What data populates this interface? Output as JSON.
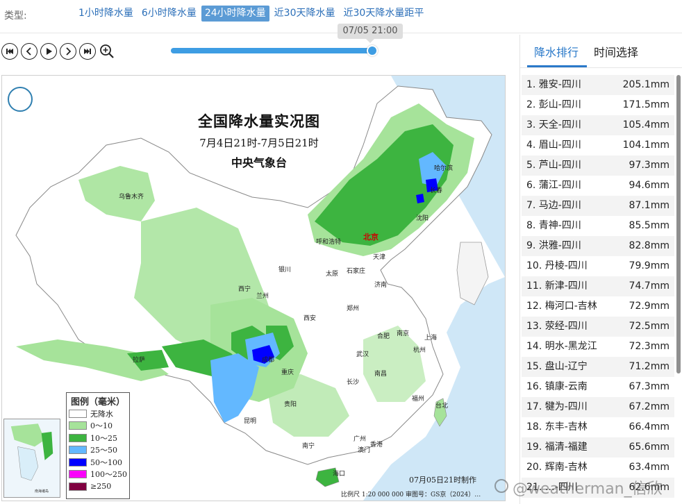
{
  "typebar": {
    "label": "类型:",
    "tabs": [
      "1小时降水量",
      "6小时降水量",
      "24小时降水量",
      "近30天降水量",
      "近30天降水量距平"
    ],
    "active_index": 2
  },
  "timeline": {
    "tooltip": "07/05 21:00",
    "progress": 1.0
  },
  "controls": {
    "icons": [
      "skip-to-start-icon",
      "previous-icon",
      "play-icon",
      "next-icon",
      "skip-to-end-icon",
      "zoom-in-icon"
    ]
  },
  "map": {
    "title": "全国降水量实况图",
    "period": "7月4日21时-7月5日21时",
    "agency": "中央气象台",
    "cities": {
      "urumqi": "乌鲁木齐",
      "lhasa": "拉萨",
      "xining": "西宁",
      "lanzhou": "兰州",
      "yinchuan": "银川",
      "hohhot": "呼和浩特",
      "taiyuan": "太原",
      "shijiazhuang": "石家庄",
      "beijing": "北京",
      "tianjin": "天津",
      "jinan": "济南",
      "zhengzhou": "郑州",
      "xian": "西安",
      "chengdu": "成都",
      "chongqing": "重庆",
      "guiyang": "贵阳",
      "kunming": "昆明",
      "nanning": "南宁",
      "guangzhou": "广州",
      "hongkong": "香港",
      "macau": "澳门",
      "haikou": "海口",
      "changsha": "长沙",
      "wuhan": "武汉",
      "nanchang": "南昌",
      "hefei": "合肥",
      "nanjing": "南京",
      "shanghai": "上海",
      "hangzhou": "杭州",
      "fuzhou": "福州",
      "taipei": "台北",
      "shenyang": "沈阳",
      "changchun": "长春",
      "harbin": "哈尔滨"
    },
    "legend": {
      "title": "图例（毫米）",
      "items": [
        {
          "label": "无降水",
          "color": "#ffffff"
        },
        {
          "label": "0～10",
          "color": "#a6e39a"
        },
        {
          "label": "10～25",
          "color": "#3db440"
        },
        {
          "label": "25～50",
          "color": "#63b8ff"
        },
        {
          "label": "50～100",
          "color": "#0000ff"
        },
        {
          "label": "100～250",
          "color": "#fa00fa"
        },
        {
          "label": "≥250",
          "color": "#800040"
        }
      ]
    },
    "footer_made": "07月05日21时制作",
    "footer_scale": "比例尺 1:20 000 000   审图号：GS京（2024）…",
    "watermark": "@weatherman_信欣"
  },
  "ranking": {
    "tabs": [
      "降水排行",
      "时间选择"
    ],
    "active_index": 0,
    "items": [
      {
        "rank": "1.",
        "name": "雅安-四川",
        "value": "205.1mm"
      },
      {
        "rank": "2.",
        "name": "彭山-四川",
        "value": "171.5mm"
      },
      {
        "rank": "3.",
        "name": "天全-四川",
        "value": "105.4mm"
      },
      {
        "rank": "4.",
        "name": "眉山-四川",
        "value": "104.1mm"
      },
      {
        "rank": "5.",
        "name": "芦山-四川",
        "value": "97.3mm"
      },
      {
        "rank": "6.",
        "name": "蒲江-四川",
        "value": "94.6mm"
      },
      {
        "rank": "7.",
        "name": "马边-四川",
        "value": "87.1mm"
      },
      {
        "rank": "8.",
        "name": "青神-四川",
        "value": "85.5mm"
      },
      {
        "rank": "9.",
        "name": "洪雅-四川",
        "value": "82.8mm"
      },
      {
        "rank": "10.",
        "name": "丹棱-四川",
        "value": "79.9mm"
      },
      {
        "rank": "11.",
        "name": "新津-四川",
        "value": "74.7mm"
      },
      {
        "rank": "12.",
        "name": "梅河口-吉林",
        "value": "72.9mm"
      },
      {
        "rank": "13.",
        "name": "荥经-四川",
        "value": "72.5mm"
      },
      {
        "rank": "14.",
        "name": "明水-黑龙江",
        "value": "72.3mm"
      },
      {
        "rank": "15.",
        "name": "盘山-辽宁",
        "value": "71.2mm"
      },
      {
        "rank": "16.",
        "name": "镇康-云南",
        "value": "67.3mm"
      },
      {
        "rank": "17.",
        "name": "犍为-四川",
        "value": "67.2mm"
      },
      {
        "rank": "18.",
        "name": "东丰-吉林",
        "value": "66.4mm"
      },
      {
        "rank": "19.",
        "name": "福清-福建",
        "value": "65.6mm"
      },
      {
        "rank": "20.",
        "name": "辉南-吉林",
        "value": "63.4mm"
      },
      {
        "rank": "21.",
        "name": "…-四川",
        "value": "62.6mm"
      }
    ]
  }
}
